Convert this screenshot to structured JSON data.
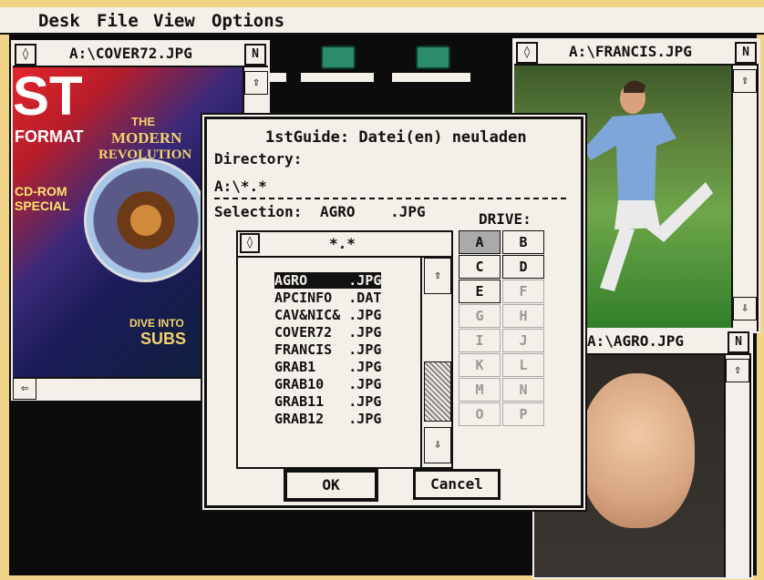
{
  "menubar": {
    "items": [
      "Desk",
      "File",
      "View",
      "Options"
    ]
  },
  "windows": {
    "cover": {
      "title": "A:\\COVER72.JPG",
      "close_glyph": "◊",
      "full_glyph": "N"
    },
    "francis": {
      "title": "A:\\FRANCIS.JPG",
      "close_glyph": "◊",
      "full_glyph": "N"
    },
    "agro": {
      "title": "A:\\AGRO.JPG",
      "full_glyph": "N"
    }
  },
  "cover_image": {
    "masthead": "ST",
    "format_word": "FORMAT",
    "headline_line1": "THE",
    "headline_line2": "MODERN",
    "headline_line3": "REVOLUTION",
    "cdrom_line1": "CD-ROM",
    "cdrom_line2": "SPECIAL",
    "dive": "DIVE INTO",
    "subs": "SUBS"
  },
  "scroll": {
    "up": "⇧",
    "down": "⇩",
    "left": "⇦"
  },
  "dialog": {
    "title": "1stGuide: Datei(en) neuladen",
    "directory_label": "Directory:",
    "directory_value": "A:\\*.*",
    "selection_label": "Selection:",
    "selection_value": "AGRO    .JPG",
    "filter_pattern": "*.*",
    "close_glyph": "◊",
    "drive_label": "DRIVE:",
    "drives": [
      {
        "letter": "A",
        "state": "active"
      },
      {
        "letter": "B",
        "state": "on"
      },
      {
        "letter": "C",
        "state": "on"
      },
      {
        "letter": "D",
        "state": "on"
      },
      {
        "letter": "E",
        "state": "on"
      },
      {
        "letter": "F",
        "state": "off"
      },
      {
        "letter": "G",
        "state": "off"
      },
      {
        "letter": "H",
        "state": "off"
      },
      {
        "letter": "I",
        "state": "off"
      },
      {
        "letter": "J",
        "state": "off"
      },
      {
        "letter": "K",
        "state": "off"
      },
      {
        "letter": "L",
        "state": "off"
      },
      {
        "letter": "M",
        "state": "off"
      },
      {
        "letter": "N",
        "state": "off"
      },
      {
        "letter": "O",
        "state": "off"
      },
      {
        "letter": "P",
        "state": "off"
      }
    ],
    "files": [
      {
        "name": "AGRO     .JPG",
        "selected": true
      },
      {
        "name": "APCINFO  .DAT",
        "selected": false
      },
      {
        "name": "CAV&NIC& .JPG",
        "selected": false
      },
      {
        "name": "COVER72  .JPG",
        "selected": false
      },
      {
        "name": "FRANCIS  .JPG",
        "selected": false
      },
      {
        "name": "GRAB1    .JPG",
        "selected": false
      },
      {
        "name": "GRAB10   .JPG",
        "selected": false
      },
      {
        "name": "GRAB11   .JPG",
        "selected": false
      },
      {
        "name": "GRAB12   .JPG",
        "selected": false
      }
    ],
    "ok_label": "OK",
    "cancel_label": "Cancel"
  },
  "colors": {
    "frame": "#f2d489",
    "desktop": "#0c0c0c",
    "window_chrome": "#f4efe8",
    "drive_icon": "#2b8c6a"
  }
}
